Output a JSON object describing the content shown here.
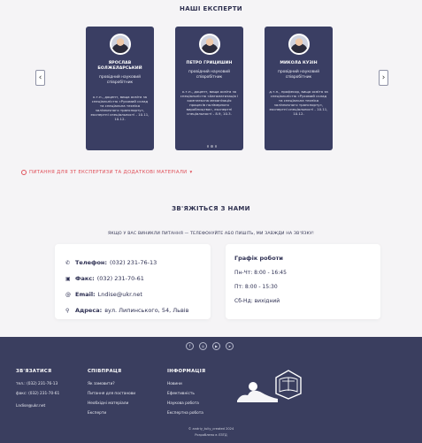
{
  "experts": {
    "title": "НАШІ ЕКСПЕРТИ",
    "prev_label": "‹",
    "next_label": "›",
    "cards": [
      {
        "name": "ЯРОСЛАВ БОЛЖЕЛАРСЬКИЙ",
        "position": "провідний науковий співробітник",
        "description": "к.т.н., доцент, вища освіта за спеціальністю «Рухомий склад та спеціальна техніка залізничного транспорту», експертні спеціальності - 10.11, 10.12."
      },
      {
        "name": "ПЕТРО ГРИЦИШИН",
        "position": "провідний науковий співробітник",
        "description": "к.т.н., доцент, вища освіта за спеціальністю «Автоматизація і комплексна механізація процесів полімерного виробництва», експертні спеціальності - 8.9, 10.3."
      },
      {
        "name": "МИКОЛА КУЗІН",
        "position": "провідний науковий співробітник",
        "description": "д.т.н., професор, вища освіта за спеціальністю «Рухомий склад та спеціальна техніка залізничного транспорту», експертні спеціальності - 10.11, 10.12."
      }
    ],
    "faq_link": "ПИТАННЯ ДЛЯ ЗТ ЕКСПЕРТИЗИ ТА ДОДАТКОВІ МАТЕРІАЛИ"
  },
  "contact": {
    "title": "ЗВ'ЯЖІТЬСЯ З НАМИ",
    "subtitle": "ЯКЩО У ВАС ВИНИКЛИ ПИТАННЯ — ТЕЛЕФОНУЙТЕ АБО ПИШІТЬ, МИ ЗАВЖДИ НА ЗВ'ЯЗКУ!",
    "phone_label": "Телефон:",
    "phone_value": "(032) 231-76-13",
    "fax_label": "Факс:",
    "fax_value": "(032) 231-70-61",
    "email_label": "Email:",
    "email_value": "Lndise@ukr.net",
    "address_label": "Адреса:",
    "address_value": "вул. Липинського, 54, Львів",
    "hours_title": "Графік роботи",
    "hours": [
      "Пн-Чт: 8:00 - 16:45",
      "Пт: 8:00 - 15:30",
      "Сб-Нд: вихідний"
    ]
  },
  "footer": {
    "social_icons": [
      "facebook-icon",
      "instagram-icon",
      "youtube-icon",
      "telegram-icon"
    ],
    "col1_title": "ЗВ'ЯЗАТИСЯ",
    "col1_items": [
      "тел.: (032) 231-76-13",
      "факс: (032) 231-70-61",
      "Lndise@ukr.net"
    ],
    "col2_title": "СПІВПРАЦЯ",
    "col2_items": [
      "Як замовити?",
      "Питання для постанови",
      "Необхідні матеріали",
      "Експерти"
    ],
    "col3_title": "ІНФОРМАЦІЯ",
    "col3_items": [
      "Новини",
      "Ефективність",
      "Наукова робота",
      "Експертна робота"
    ],
    "copyright": "© andriy_tuliy_created 2024",
    "credit": "Розроблено в ЛЗТД"
  }
}
